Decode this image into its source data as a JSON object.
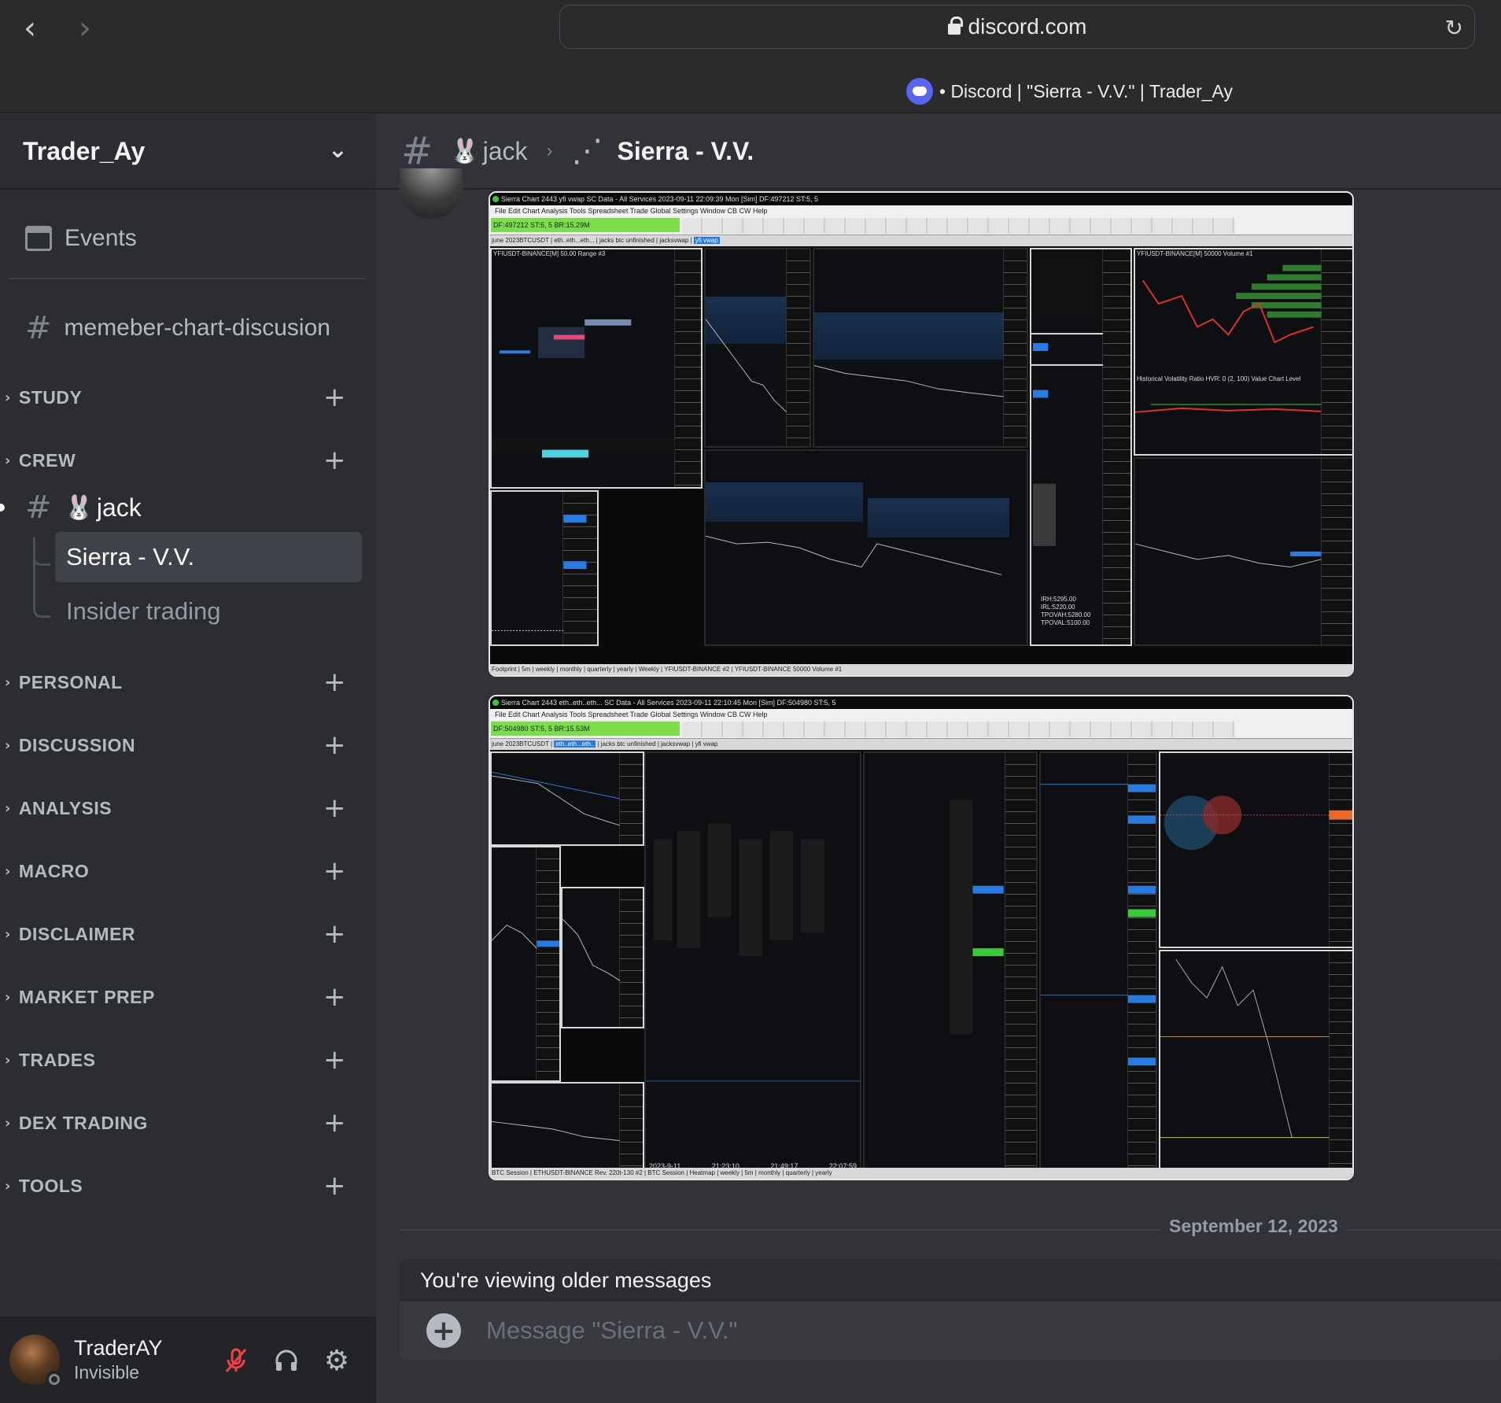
{
  "browser": {
    "url": "discord.com",
    "tab_title": "• Discord | \"Sierra - V.V.\" | Trader_Ay",
    "back_icon": "chevron-left-icon",
    "forward_icon": "chevron-right-icon",
    "reload_icon": "reload-icon"
  },
  "server": {
    "name": "Trader_Ay"
  },
  "sidebar": {
    "events_label": "Events",
    "top_channel": "memeber-chart-discusion",
    "categories": [
      {
        "name": "STUDY"
      },
      {
        "name": "CREW"
      },
      {
        "name": "PERSONAL"
      },
      {
        "name": "DISCUSSION"
      },
      {
        "name": "ANALYSIS"
      },
      {
        "name": "MACRO"
      },
      {
        "name": "DISCLAIMER"
      },
      {
        "name": "MARKET PREP"
      },
      {
        "name": "TRADES"
      },
      {
        "name": "DEX TRADING"
      },
      {
        "name": "TOOLS"
      }
    ],
    "crew_channel": {
      "emoji": "🐰",
      "name": "jack",
      "threads": [
        {
          "name": "Sierra - V.V.",
          "active": true
        },
        {
          "name": "Insider trading",
          "active": false
        }
      ]
    }
  },
  "user": {
    "name": "TraderAY",
    "status": "Invisible"
  },
  "header": {
    "channel_emoji": "🐰",
    "channel": "jack",
    "thread": "Sierra - V.V."
  },
  "attachments": [
    {
      "title": "Sierra Chart 2443 yfi vwap  SC Data - All Services 2023-09-11  22:09:39 Mon [Sim]  DF:497212  ST:5, 5",
      "menu": "File   Edit   Chart   Analysis   Tools   Spreadsheet   Trade   Global Settings   Window   CB   CW   Help",
      "status_bar": "DF:497212  ST:5, 5  BR:15.29M",
      "tabs": [
        "june 2023BTCUSDT",
        "eth..eth...eth...",
        "jacks btc unfinished",
        "jacksvwap",
        "yfi vwap"
      ],
      "active_tab": "yfi vwap",
      "footer": "Footprint | 5m | weekly | monthly | quarterly | yearly | Weekly | YFIUSDT-BINANCE #2 | YFIUSDT-BINANCE 50000 Volume #1",
      "pane_label_1": "YFIUSDT-BINANCE[M]  50.00 Range #3",
      "pane_label_2": "YFIUSDT-BINANCE[M]  50000 Volume #1",
      "hvr_label": "Historical Volatility Ratio  HVR: 0   (2, 100)  Value Chart Level",
      "ib_info": "IRH:5295.00\nIRL:5220.00\nTPOVAH:5280.00\nTPOVAL:5100.00"
    },
    {
      "title": "Sierra Chart 2443 eth..eth..eth...  SC Data - All Services 2023-09-11  22:10:45 Mon [Sim]  DF:504980  ST:5, 5",
      "menu": "File   Edit   Chart   Analysis   Tools   Spreadsheet   Trade   Global Settings   Window   CB   CW   Help",
      "status_bar": "DF:504980  ST:5, 5  BR:15.53M",
      "tabs": [
        "june 2023BTCUSDT",
        "eth..eth...eth..",
        "jacks btc unfinished",
        "jacksvwap",
        "yfi vwap"
      ],
      "active_tab": "eth..eth...eth..",
      "footer": "BTC Session | ETHUSDT-BINANCE Rev. 220t-130 #2 | BTC Session | Heatmap | weekly | 5m | monthly | quarterly | yearly",
      "time_labels": [
        "2023-9-11",
        "21:23:10",
        "21:49:17",
        "22:07:59"
      ]
    }
  ],
  "date_divider": "September 12, 2023",
  "older_notice": "You're viewing older messages",
  "composer": {
    "placeholder": "Message \"Sierra - V.V.\""
  },
  "colors": {
    "accent": "#5865f2",
    "sidebar_bg": "#2b2d31",
    "main_bg": "#313338",
    "active_item": "#404249",
    "toolbar_green": "#7ddc4a",
    "chart_blue": "#2a7be0"
  }
}
